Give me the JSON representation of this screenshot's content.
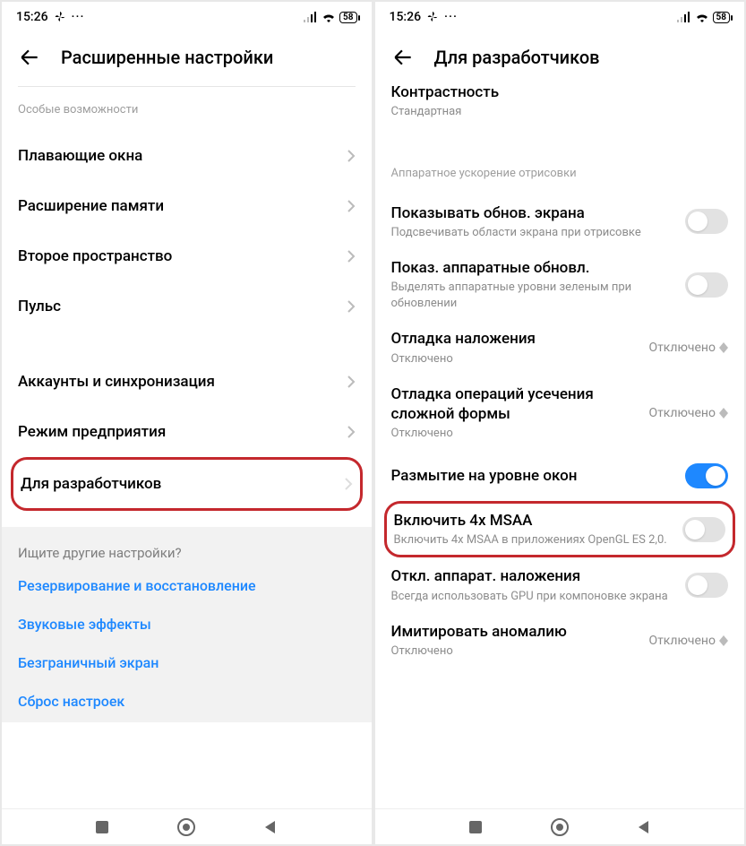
{
  "status": {
    "time": "15:26",
    "battery": "58"
  },
  "left": {
    "title": "Расширенные настройки",
    "section1": "Особые возможности",
    "rows": [
      {
        "label": "Плавающие окна"
      },
      {
        "label": "Расширение памяти"
      },
      {
        "label": "Второе пространство"
      },
      {
        "label": "Пульс"
      }
    ],
    "rows2": [
      {
        "label": "Аккаунты и синхронизация"
      },
      {
        "label": "Режим предприятия"
      }
    ],
    "dev": "Для разработчиков",
    "search_prompt": "Ищите другие настройки?",
    "links": [
      "Резервирование и восстановление",
      "Звуковые эффекты",
      "Безграничный экран",
      "Сброс настроек"
    ]
  },
  "right": {
    "title": "Для разработчиков",
    "top_partial_title": "Контрастность",
    "top_partial_sub": "Стандартная",
    "section": "Аппаратное ускорение отрисовки",
    "items": {
      "show_updates": {
        "t": "Показывать обнов. экрана",
        "s": "Подсвечивать области экрана при отрисовке"
      },
      "hw_updates": {
        "t": "Показ. аппаратные обновл.",
        "s": "Выделять аппаратные уровни зеленым при обновлении"
      },
      "overlay_debug": {
        "t": "Отладка наложения",
        "s": "Отключено",
        "v": "Отключено"
      },
      "clip_debug": {
        "t": "Отладка операций усечения сложной формы",
        "s": "Отключено",
        "v": "Отключено"
      },
      "blur": {
        "t": "Размытие на уровне окон"
      },
      "msaa": {
        "t": "Включить 4x MSAA",
        "s": "Включить 4x MSAA в приложениях OpenGL ES 2,0."
      },
      "disable_hw": {
        "t": "Откл. аппарат. наложения",
        "s": "Всегда использовать GPU при компоновке экрана"
      },
      "anomaly": {
        "t": "Имитировать аномалию",
        "s": "Отключено",
        "v": "Отключено"
      }
    }
  }
}
